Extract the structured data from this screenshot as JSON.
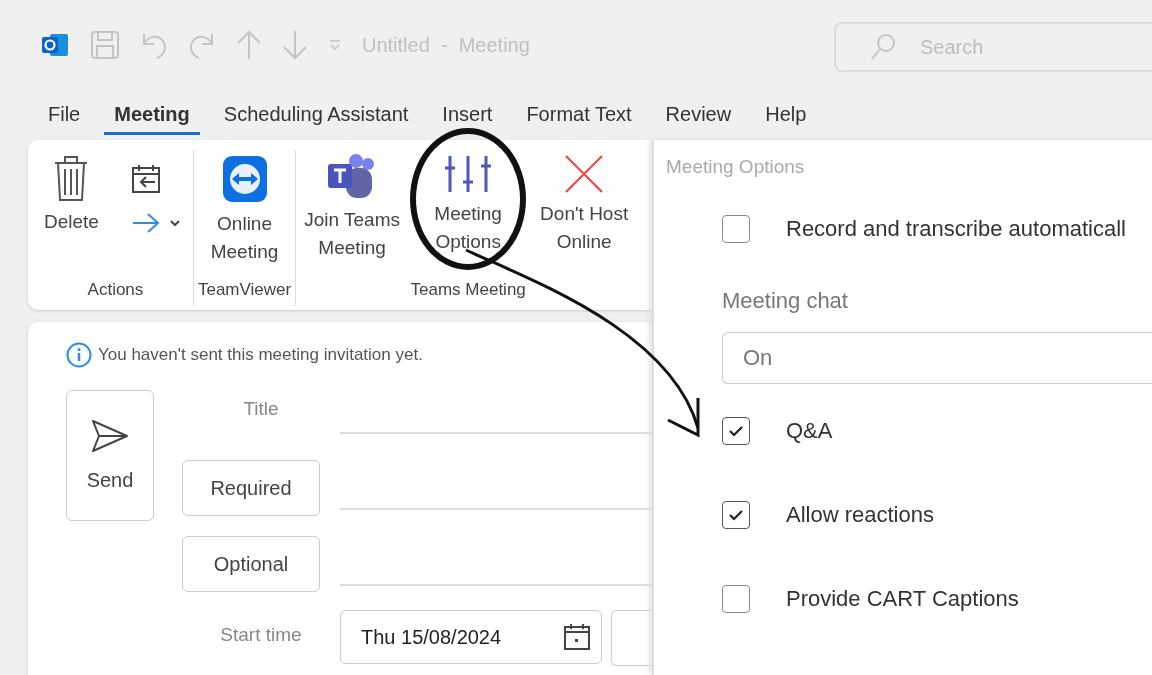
{
  "title_bar": {
    "title": "Untitled  -  Meeting",
    "search": {
      "placeholder": "Search"
    }
  },
  "tabs": [
    {
      "label": "File",
      "selected": false
    },
    {
      "label": "Meeting",
      "selected": true
    },
    {
      "label": "Scheduling Assistant",
      "selected": false
    },
    {
      "label": "Insert",
      "selected": false
    },
    {
      "label": "Format Text",
      "selected": false
    },
    {
      "label": "Review",
      "selected": false
    },
    {
      "label": "Help",
      "selected": false
    }
  ],
  "ribbon": {
    "groups": [
      {
        "label": "Actions",
        "buttons": [
          {
            "kind": "delete",
            "label": "Delete"
          },
          {
            "kind": "calendar-forward"
          }
        ]
      },
      {
        "label": "TeamViewer",
        "buttons": [
          {
            "kind": "teamviewer",
            "label": "Online Meeting"
          }
        ]
      },
      {
        "label": "Teams Meeting",
        "buttons": [
          {
            "kind": "teams",
            "label": "Join Teams Meeting"
          },
          {
            "kind": "options",
            "label": "Meeting Options"
          },
          {
            "kind": "no-host",
            "label": "Don't Host Online"
          }
        ]
      }
    ]
  },
  "form": {
    "notice": "You haven't sent this meeting invitation yet.",
    "send": "Send",
    "title_label": "Title",
    "recipients": [
      "Required",
      "Optional"
    ],
    "start_time_label": "Start time",
    "start_date": "Thu 15/08/2024"
  },
  "meeting_options": {
    "title": "Meeting Options",
    "items": [
      {
        "kind": "checkbox",
        "label": "Record and transcribe automaticall",
        "checked": false
      },
      {
        "kind": "select",
        "label": "Meeting chat",
        "value": "On"
      },
      {
        "kind": "checkbox",
        "label": "Q&A",
        "checked": true
      },
      {
        "kind": "checkbox",
        "label": "Allow reactions",
        "checked": true
      },
      {
        "kind": "checkbox",
        "label": "Provide CART Captions",
        "checked": false
      }
    ]
  }
}
